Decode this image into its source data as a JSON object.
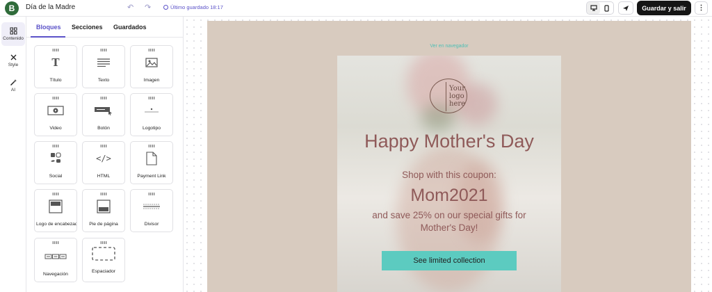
{
  "header": {
    "brand_letter": "B",
    "doc_title": "Día de la Madre",
    "saved_text": "Último guardado 18:17",
    "save_exit_label": "Guardar y salir"
  },
  "rail": {
    "items": [
      {
        "label": "Contenido",
        "icon": "grid-icon"
      },
      {
        "label": "Style",
        "icon": "brush-icon"
      },
      {
        "label": "AI",
        "icon": "magic-wand-icon"
      }
    ]
  },
  "panel": {
    "tabs": [
      "Bloques",
      "Secciones",
      "Guardados"
    ],
    "active_tab": "Bloques",
    "blocks": [
      {
        "label": "Título",
        "icon": "title-icon"
      },
      {
        "label": "Texto",
        "icon": "text-icon"
      },
      {
        "label": "Imagen",
        "icon": "image-icon"
      },
      {
        "label": "Video",
        "icon": "video-icon"
      },
      {
        "label": "Botón",
        "icon": "button-icon"
      },
      {
        "label": "Logotipo",
        "icon": "logo-icon"
      },
      {
        "label": "Social",
        "icon": "social-icon"
      },
      {
        "label": "HTML",
        "icon": "code-icon"
      },
      {
        "label": "Payment Link",
        "icon": "payment-link-icon"
      },
      {
        "label": "Logo de encabezado",
        "icon": "header-logo-icon"
      },
      {
        "label": "Pie de página",
        "icon": "footer-icon"
      },
      {
        "label": "Divisor",
        "icon": "divider-icon"
      },
      {
        "label": "Navegación",
        "icon": "navigation-icon"
      },
      {
        "label": "Espaciador",
        "icon": "spacer-icon"
      }
    ]
  },
  "email": {
    "view_in_browser": "Ver en navegador",
    "logo_text": "Your logo here",
    "headline": "Happy Mother's Day",
    "subhead": "Shop with this coupon:",
    "coupon_code": "Mom2021",
    "body": "and save 25% on our special gifts for Mother's Day!",
    "cta_label": "See limited collection"
  },
  "colors": {
    "accent": "#5b52c8",
    "brand": "#2f6b3a",
    "email_background": "#d8cbbf",
    "headline_text": "#8f5a59",
    "cta_background": "#5ccbc0",
    "link": "#4fbfb5"
  }
}
